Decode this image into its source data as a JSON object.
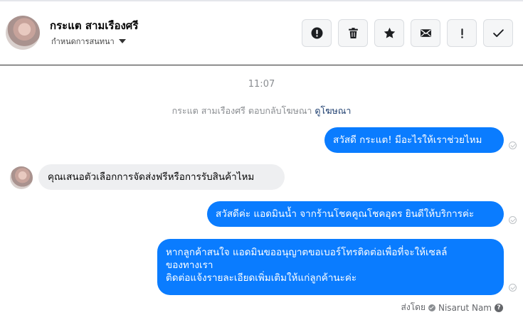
{
  "header": {
    "contact_name": "กระแต สามเรืองศรี",
    "conversation_settings": "กำหนดการสนทนา",
    "toolbar": [
      {
        "name": "spam-button",
        "icon": "alert-circle-icon"
      },
      {
        "name": "delete-button",
        "icon": "trash-icon"
      },
      {
        "name": "star-button",
        "icon": "star-icon"
      },
      {
        "name": "mark-unread-button",
        "icon": "envelope-icon"
      },
      {
        "name": "follow-up-button",
        "icon": "exclamation-icon"
      },
      {
        "name": "done-button",
        "icon": "check-icon"
      }
    ]
  },
  "conversation": {
    "timestamp": "11:07",
    "reply_notice": {
      "text": "กระแต สามเรืองศรี ตอบกลับโฆษณา",
      "link": "ดูโฆษณา"
    },
    "messages": [
      {
        "direction": "out",
        "lines": [
          "สวัสดี กระแต! มีอะไรให้เราช่วยไหม"
        ]
      },
      {
        "direction": "in",
        "lines": [
          "คุณเสนอตัวเลือกการจัดส่งฟรีหรือการรับสินค้าไหม"
        ]
      },
      {
        "direction": "out",
        "lines": [
          "สวัสดีค่ะ แอดมินน้ำ จากร้านโชคคูณโชคอุดร ยินดีให้บริการค่ะ"
        ]
      },
      {
        "direction": "out",
        "lines": [
          "หากลูกค้าสนใจ แอดมินขออนุญาตขอเบอร์โทรติดต่อเพื่อที่จะให้เซลล์",
          "ของทางเรา",
          "ติดต่อแจ้งรายละเอียดเพิ่มเติมให้แก่ลูกค้านะค่ะ"
        ]
      }
    ],
    "sent_by_label": "ส่งโดย",
    "sent_by_name": "Nisarut Nam"
  },
  "colors": {
    "outgoing_bubble": "#0a7cff",
    "incoming_bubble": "#eeeff1",
    "link": "#1c3d6e"
  }
}
